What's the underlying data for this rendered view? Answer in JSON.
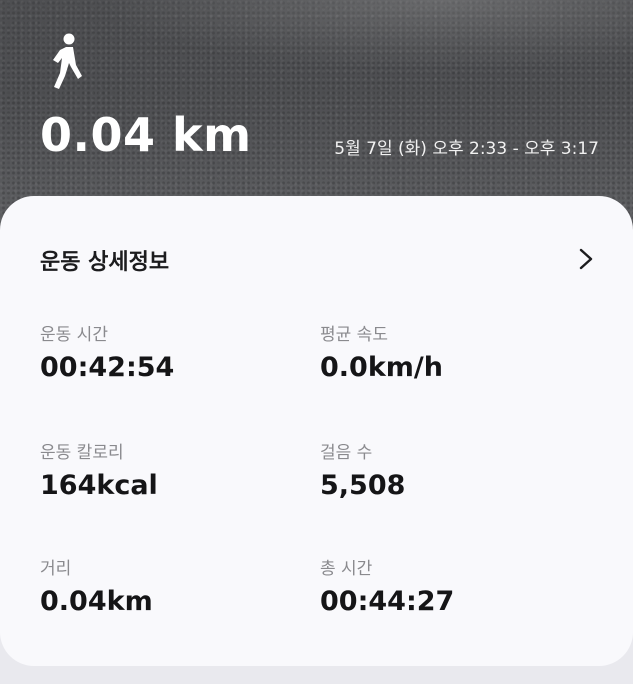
{
  "hero": {
    "icon": "walking-person-icon",
    "distance": "0.04 km",
    "datetime": "5월 7일 (화) 오후 2:33 - 오후 3:17"
  },
  "details": {
    "title": "운동 상세정보",
    "chevron_icon": "chevron-right-icon",
    "stats": [
      {
        "label": "운동 시간",
        "value": "00:42:54"
      },
      {
        "label": "평균 속도",
        "value": "0.0km/h"
      },
      {
        "label": "운동 칼로리",
        "value": "164kcal"
      },
      {
        "label": "걸음 수",
        "value": "5,508"
      },
      {
        "label": "거리",
        "value": "0.04km"
      },
      {
        "label": "총 시간",
        "value": "00:44:27"
      }
    ]
  },
  "colors": {
    "card_background": "#f9f9fc",
    "label_gray": "#8a8a8e",
    "value_text": "#151517",
    "hero_text": "#ffffff"
  }
}
